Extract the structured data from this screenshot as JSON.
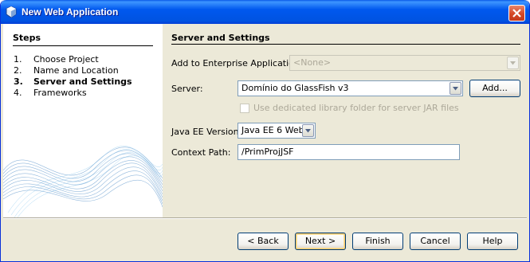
{
  "window": {
    "title": "New Web Application"
  },
  "steps": {
    "heading": "Steps",
    "items": [
      {
        "number": "1.",
        "label": "Choose Project",
        "current": false
      },
      {
        "number": "2.",
        "label": "Name and Location",
        "current": false
      },
      {
        "number": "3.",
        "label": "Server and Settings",
        "current": true
      },
      {
        "number": "4.",
        "label": "Frameworks",
        "current": false
      }
    ]
  },
  "form": {
    "heading": "Server and Settings",
    "enterprise_label": "Add to Enterprise Application:",
    "enterprise_value": "<None>",
    "server_label": "Server:",
    "server_value": "Domínio do GlassFish v3",
    "add_button": "Add...",
    "library_checkbox_label": "Use dedicated library folder for server JAR files",
    "library_checked": false,
    "javaee_label": "Java EE Version:",
    "javaee_value": "Java EE 6 Web",
    "context_label": "Context Path:",
    "context_value": "/PrimProjJSF"
  },
  "buttons": {
    "back": "< Back",
    "next": "Next >",
    "finish": "Finish",
    "cancel": "Cancel",
    "help": "Help"
  },
  "colors": {
    "titlebar": "#0058ee",
    "dialog_bg": "#ece9d8",
    "wave": "#3a7fc0"
  }
}
